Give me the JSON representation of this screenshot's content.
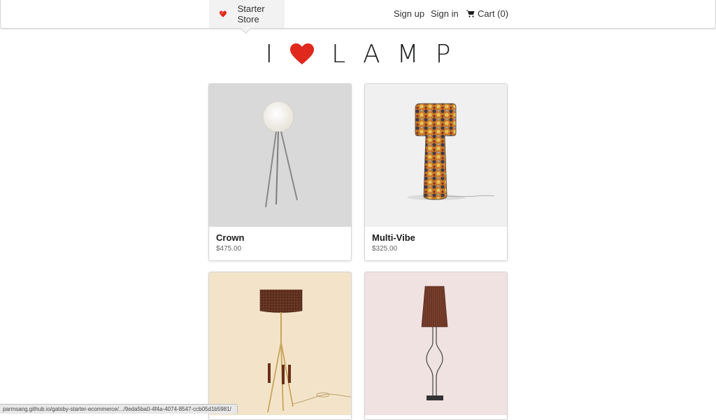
{
  "nav": {
    "brand_label": "Starter Store",
    "signup_label": "Sign up",
    "signin_label": "Sign in",
    "cart_label": "Cart (0)"
  },
  "hero": {
    "letter_i": "I",
    "word": "LAMP",
    "heart_color": "#e0281c"
  },
  "products": [
    {
      "name": "Crown",
      "price": "$475.00",
      "image": "white-globe-tripod-floor-lamp",
      "bg": "#d9d9d9"
    },
    {
      "name": "Multi-Vibe",
      "price": "$325.00",
      "image": "patterned-fabric-floor-lamp",
      "bg": "#f0f0f0"
    },
    {
      "name": "",
      "price": "",
      "image": "brown-shade-brass-tripod-lamp",
      "bg": "#f3e4c9"
    },
    {
      "name": "",
      "price": "",
      "image": "tall-brown-shade-wire-lamp",
      "bg": "#f0e2e1"
    }
  ],
  "status_url": "parmsang.github.io/gatsby-starter-ecommerce/.../9eda5ba0-4f4a-4074-8547-ccb05d1b5981/"
}
